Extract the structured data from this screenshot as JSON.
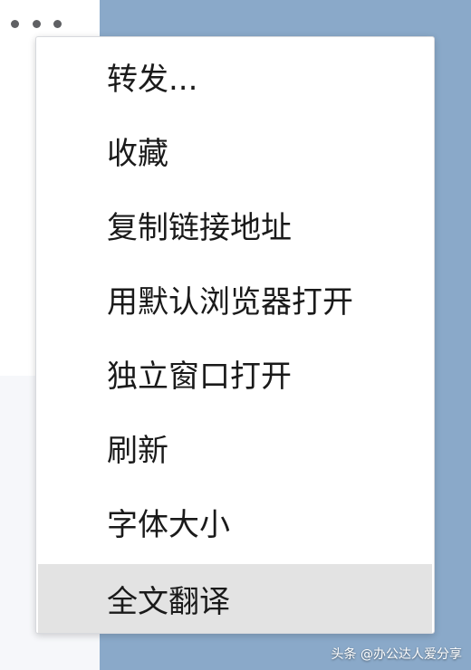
{
  "menu": {
    "items": [
      {
        "label": "转发..."
      },
      {
        "label": "收藏"
      },
      {
        "label": "复制链接地址"
      },
      {
        "label": "用默认浏览器打开"
      },
      {
        "label": "独立窗口打开"
      },
      {
        "label": "刷新"
      },
      {
        "label": "字体大小"
      },
      {
        "label": "全文翻译"
      }
    ],
    "selected_index": 7
  },
  "watermark": "头条 @办公达人爱分享",
  "colors": {
    "background_right": "#8aa9c9",
    "menu_bg": "#ffffff",
    "selected_bg": "#e3e3e3",
    "text": "#1a1a1a"
  },
  "icons": {
    "more": "more-horizontal-icon"
  }
}
